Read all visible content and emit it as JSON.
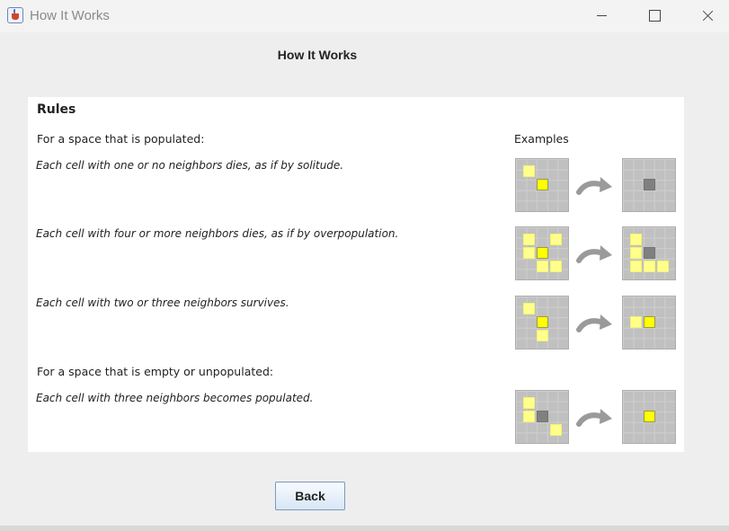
{
  "window": {
    "title": "How It Works",
    "icon": "java-cup-icon"
  },
  "heading": "How It Works",
  "panel": {
    "rules_title": "Rules",
    "populated_section": "For a space that is populated:",
    "examples_label": "Examples",
    "rules": [
      "Each cell with one or no neighbors dies, as if by solitude.",
      "Each cell with four or more neighbors dies, as if by overpopulation.",
      "Each cell with two or three neighbors survives."
    ],
    "empty_section": "For a space that is empty or unpopulated:",
    "empty_rule": "Each cell with three neighbors becomes populated.",
    "arrow_icon": "curved-arrow-icon"
  },
  "colors": {
    "cell_neighbor": "#ffff8a",
    "cell_focus": "#ffff00",
    "cell_dead": "#808080",
    "grid_bg": "#c0c0c0"
  },
  "back_button": "Back"
}
